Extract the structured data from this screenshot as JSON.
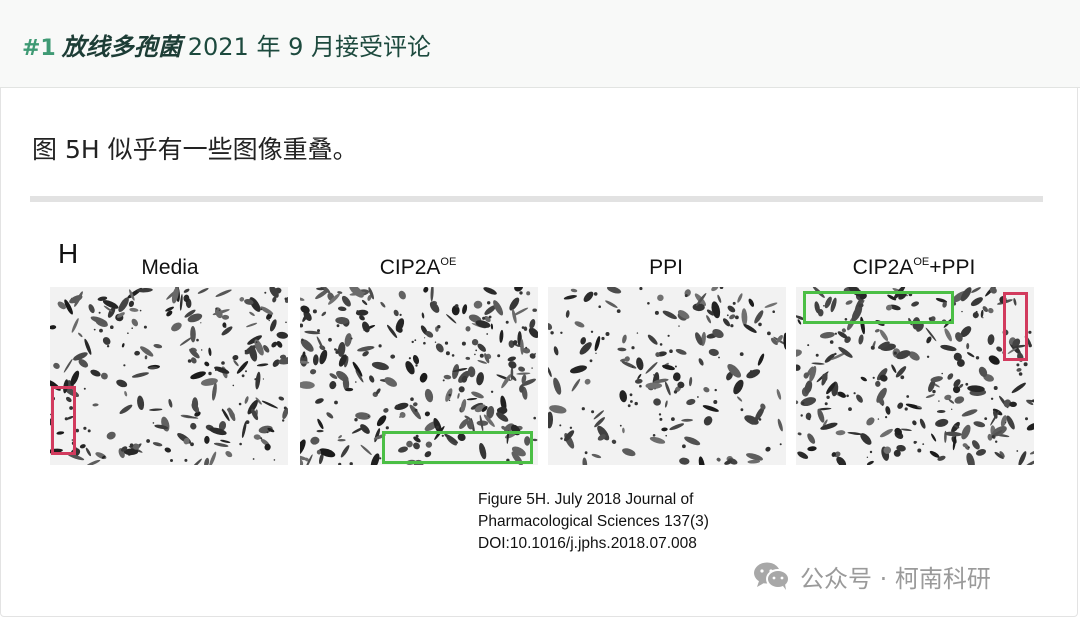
{
  "header": {
    "number": "#1",
    "keyword": "放线多孢菌",
    "rest": "2021 年 9 月接受评论"
  },
  "comment": "图 5H 似乎有一些图像重叠。",
  "figure": {
    "panel_letter": "H",
    "panels": [
      {
        "title": "Media",
        "sup": "",
        "suffix": ""
      },
      {
        "title": "CIP2A",
        "sup": "OE",
        "suffix": ""
      },
      {
        "title": "PPI",
        "sup": "",
        "suffix": ""
      },
      {
        "title": "CIP2A",
        "sup": "OE",
        "suffix": "+PPI"
      }
    ],
    "highlight_colors": {
      "red": "#d23b5e",
      "green": "#4bbf45"
    },
    "caption": [
      "Figure 5H. July 2018 Journal of",
      "Pharmacological Sciences 137(3)",
      "DOI:10.1016/j.jphs.2018.07.008"
    ]
  },
  "watermark": {
    "icon": "wechat-icon",
    "text": "公众号 · 柯南科研"
  }
}
